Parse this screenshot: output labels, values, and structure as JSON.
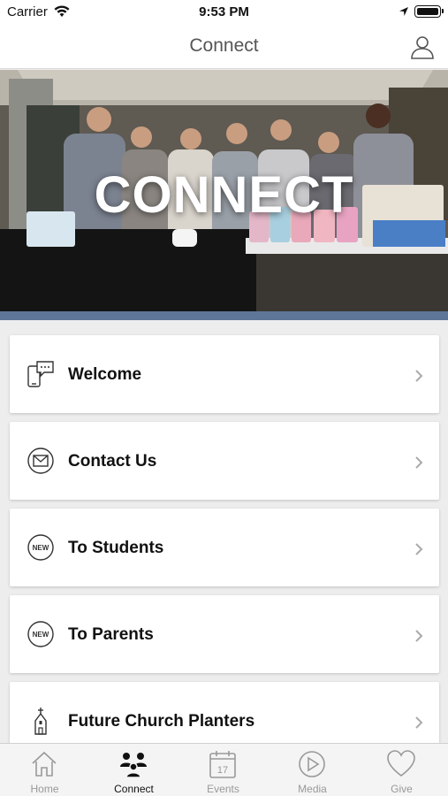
{
  "status_bar": {
    "carrier": "Carrier",
    "time": "9:53 PM"
  },
  "nav": {
    "title": "Connect",
    "profile_icon": "profile-icon"
  },
  "hero": {
    "title": "CONNECT"
  },
  "list": {
    "items": [
      {
        "label": "Welcome",
        "icon": "chat-phone-icon"
      },
      {
        "label": "Contact Us",
        "icon": "mail-icon"
      },
      {
        "label": "To Students",
        "icon": "new-badge-icon"
      },
      {
        "label": "To Parents",
        "icon": "new-badge-icon"
      },
      {
        "label": "Future Church Planters",
        "icon": "church-icon"
      }
    ]
  },
  "tabs": [
    {
      "label": "Home",
      "icon": "home-icon",
      "active": false
    },
    {
      "label": "Connect",
      "icon": "people-icon",
      "active": true
    },
    {
      "label": "Events",
      "icon": "calendar-icon",
      "active": false,
      "badge": "17"
    },
    {
      "label": "Media",
      "icon": "play-icon",
      "active": false
    },
    {
      "label": "Give",
      "icon": "heart-icon",
      "active": false
    }
  ],
  "colors": {
    "accent_bar": "#5e7797",
    "tab_inactive": "#999999",
    "tab_active": "#111111"
  }
}
